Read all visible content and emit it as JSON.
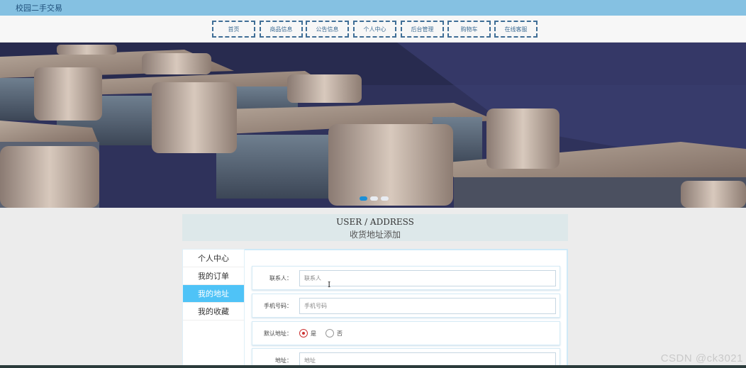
{
  "header": {
    "brand": "校园二手交易"
  },
  "nav": {
    "items": [
      {
        "label": "首页"
      },
      {
        "label": "商品信息"
      },
      {
        "label": "公告信息"
      },
      {
        "label": "个人中心"
      },
      {
        "label": "后台管理"
      },
      {
        "label": "购物车"
      },
      {
        "label": "在线客服"
      }
    ]
  },
  "banner": {
    "slide_count": 3,
    "active_slide": 1
  },
  "section": {
    "title_en": "USER / ADDRESS",
    "title_cn": "收货地址添加"
  },
  "sidebar": {
    "items": [
      {
        "label": "个人中心",
        "active": false
      },
      {
        "label": "我的订单",
        "active": false
      },
      {
        "label": "我的地址",
        "active": true
      },
      {
        "label": "我的收藏",
        "active": false
      }
    ],
    "active_color": "#4fc3f7"
  },
  "form": {
    "contact": {
      "label": "联系人：",
      "placeholder": "联系人"
    },
    "phone": {
      "label": "手机号码：",
      "placeholder": "手机号码"
    },
    "default": {
      "label": "默认地址：",
      "options": [
        "是",
        "否"
      ],
      "selected": "是"
    },
    "address": {
      "label": "地址：",
      "placeholder": "地址"
    }
  },
  "watermark": "CSDN @ck3021",
  "colors": {
    "topbar": "#85c1e2",
    "nav_border": "#3f6e96",
    "accent": "#1c8fd6"
  }
}
